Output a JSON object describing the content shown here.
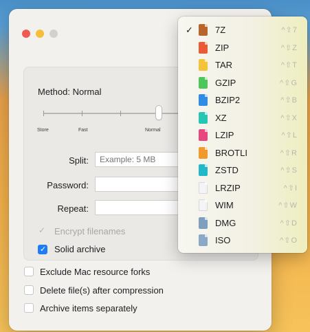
{
  "window": {
    "method_label": "Method: Normal",
    "slider_labels": [
      "Store",
      "Fast",
      "Normal"
    ],
    "split_label": "Split:",
    "split_placeholder": "Example: 5 MB",
    "password_label": "Password:",
    "repeat_label": "Repeat:",
    "encrypt_label": "Encrypt filenames",
    "solid_label": "Solid archive",
    "exclude_label": "Exclude Mac resource forks",
    "delete_label": "Delete file(s) after compression",
    "separate_label": "Archive items separately"
  },
  "menu": {
    "items": [
      {
        "name": "7Z",
        "shortcut": "^⇧7",
        "checked": true,
        "icon": "file-7z-icon",
        "color": "#b7652a"
      },
      {
        "name": "ZIP",
        "shortcut": "^⇧Z",
        "checked": false,
        "icon": "file-zip-icon",
        "color": "#ea5a35"
      },
      {
        "name": "TAR",
        "shortcut": "^⇧T",
        "checked": false,
        "icon": "file-tar-icon",
        "color": "#f4c33a"
      },
      {
        "name": "GZIP",
        "shortcut": "^⇧G",
        "checked": false,
        "icon": "file-gzip-icon",
        "color": "#4ec75a"
      },
      {
        "name": "BZIP2",
        "shortcut": "^⇧B",
        "checked": false,
        "icon": "file-bzip2-icon",
        "color": "#2e8be6"
      },
      {
        "name": "XZ",
        "shortcut": "^⇧X",
        "checked": false,
        "icon": "file-xz-icon",
        "color": "#27c6b4"
      },
      {
        "name": "LZIP",
        "shortcut": "^⇧L",
        "checked": false,
        "icon": "file-lzip-icon",
        "color": "#e8467e"
      },
      {
        "name": "BROTLI",
        "shortcut": "^⇧R",
        "checked": false,
        "icon": "file-brotli-icon",
        "color": "#f09a2e"
      },
      {
        "name": "ZSTD",
        "shortcut": "^⇧S",
        "checked": false,
        "icon": "file-zstd-icon",
        "color": "#23b8c9"
      },
      {
        "name": "LRZIP",
        "shortcut": "^⇧I",
        "checked": false,
        "icon": "file-lrzip-icon",
        "color": "#f4f4f6"
      },
      {
        "name": "WIM",
        "shortcut": "^⇧W",
        "checked": false,
        "icon": "file-wim-icon",
        "color": "#f4f4f6"
      },
      {
        "name": "DMG",
        "shortcut": "^⇧D",
        "checked": false,
        "icon": "file-dmg-icon",
        "color": "#7f9fbf"
      },
      {
        "name": "ISO",
        "shortcut": "^⇧O",
        "checked": false,
        "icon": "file-iso-icon",
        "color": "#8aa8c8"
      }
    ]
  }
}
